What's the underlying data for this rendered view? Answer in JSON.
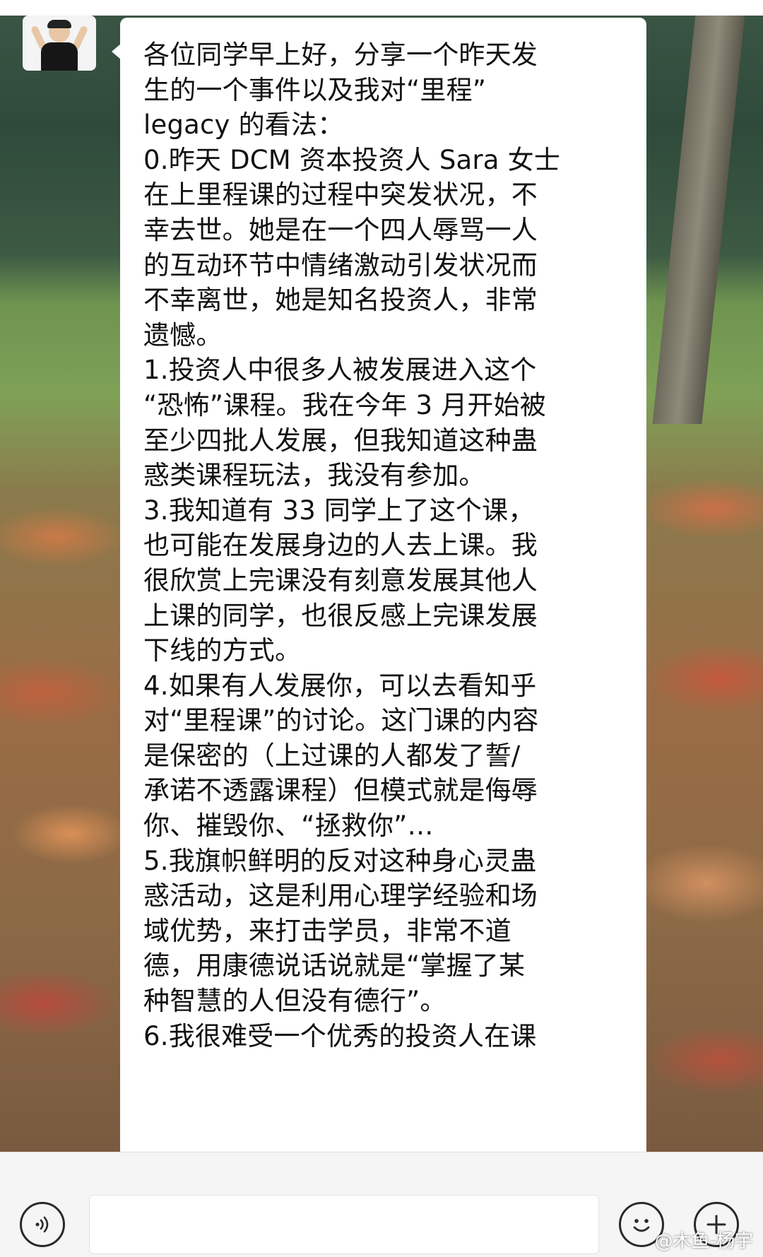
{
  "chat": {
    "message_lines": [
      "各位同学早上好，分享一个昨天发",
      "生的一个事件以及我对“里程”",
      "legacy 的看法：",
      "0.昨天 DCM 资本投资人 Sara 女士",
      "在上里程课的过程中突发状况，不",
      "幸去世。她是在一个四人辱骂一人",
      "的互动环节中情绪激动引发状况而",
      "不幸离世，她是知名投资人，非常",
      "遗憾。",
      "1.投资人中很多人被发展进入这个",
      "“恐怖”课程。我在今年 3 月开始被",
      "至少四批人发展，但我知道这种蛊",
      "惑类课程玩法，我没有参加。",
      "3.我知道有 33 同学上了这个课，",
      "也可能在发展身边的人去上课。我",
      "很欣赏上完课没有刻意发展其他人",
      "上课的同学，也很反感上完课发展",
      "下线的方式。",
      "4.如果有人发展你，可以去看知乎",
      "对“里程课”的讨论。这门课的内容",
      "是保密的（上过课的人都发了誓/",
      "承诺不透露课程）但模式就是侮辱",
      "你、摧毁你、“拯救你”…",
      "5.我旗帜鲜明的反对这种身心灵蛊",
      "惑活动，这是利用心理学经验和场",
      "域优势，来打击学员，非常不道",
      "德，用康德说话说就是“掌握了某",
      "种智慧的人但没有德行”。",
      "6.我很难受一个优秀的投资人在课"
    ]
  },
  "input_bar": {
    "voice_icon": "voice-icon",
    "emoji_icon": "emoji-icon",
    "plus_icon": "plus-icon",
    "text_value": ""
  },
  "watermark": "@木鱼-杨宇"
}
